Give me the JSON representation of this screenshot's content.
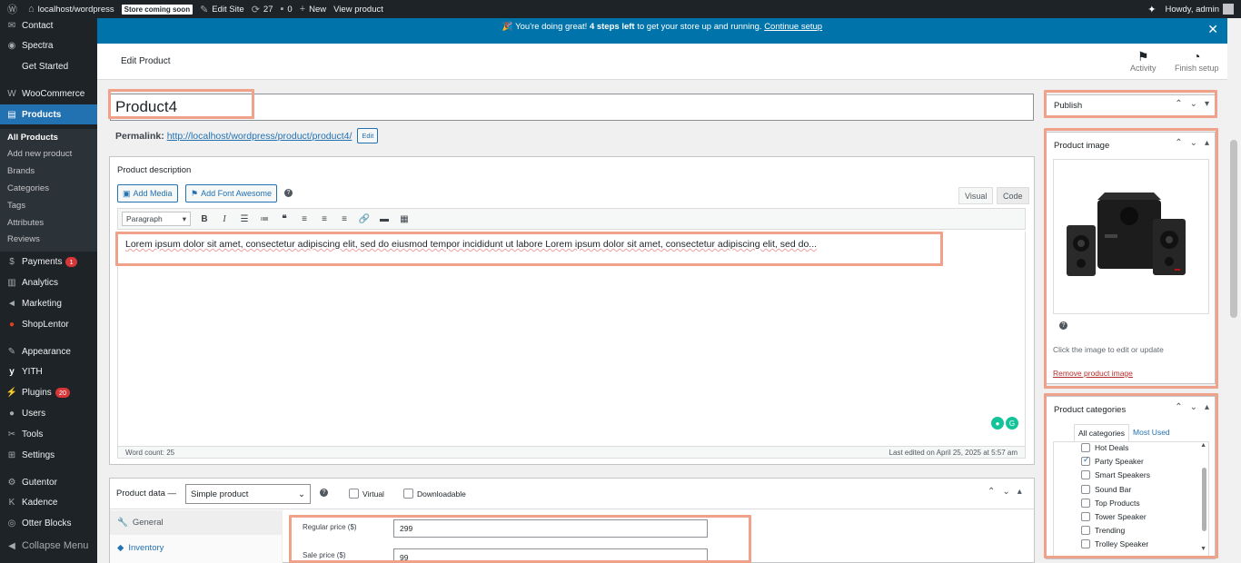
{
  "adminbar": {
    "site": "localhost/wordpress",
    "store_badge": "Store coming soon",
    "edit_site": "Edit Site",
    "updates_count": "27",
    "comments_count": "0",
    "new_label": "New",
    "view_product": "View product",
    "greeting": "Howdy, admin"
  },
  "sidebar": {
    "items": [
      {
        "label": "Contact",
        "icon": "mail-icon"
      },
      {
        "label": "Spectra",
        "icon": "spectra-icon"
      },
      {
        "label": "Get Started",
        "icon": ""
      },
      {
        "label": "WooCommerce",
        "icon": "woo-icon"
      },
      {
        "label": "Products",
        "icon": "products-icon"
      },
      {
        "label": "Payments",
        "icon": "payments-icon",
        "badge": "1"
      },
      {
        "label": "Analytics",
        "icon": "analytics-icon"
      },
      {
        "label": "Marketing",
        "icon": "marketing-icon"
      },
      {
        "label": "ShopLentor",
        "icon": "shoplentor-icon"
      },
      {
        "label": "Appearance",
        "icon": "brush-icon"
      },
      {
        "label": "YITH",
        "icon": "yith-icon"
      },
      {
        "label": "Plugins",
        "icon": "plugin-icon",
        "badge": "20"
      },
      {
        "label": "Users",
        "icon": "users-icon"
      },
      {
        "label": "Tools",
        "icon": "tools-icon"
      },
      {
        "label": "Settings",
        "icon": "settings-icon"
      },
      {
        "label": "Gutentor",
        "icon": "gutentor-icon"
      },
      {
        "label": "Kadence",
        "icon": "kadence-icon"
      },
      {
        "label": "Otter Blocks",
        "icon": "otter-icon"
      },
      {
        "label": "Collapse Menu",
        "icon": "collapse-icon"
      }
    ],
    "submenu": [
      "All Products",
      "Add new product",
      "Brands",
      "Categories",
      "Tags",
      "Attributes",
      "Reviews"
    ]
  },
  "notice": {
    "prefix": "🎉 You're doing great!",
    "bold": "4 steps left",
    "suffix": "to get your store up and running.",
    "link": "Continue setup"
  },
  "header": {
    "title": "Edit Product",
    "activity": "Activity",
    "finish_setup": "Finish setup"
  },
  "product": {
    "title": "Product4",
    "permalink_label": "Permalink:",
    "permalink_url": "http://localhost/wordpress/product/product4/",
    "edit_btn": "Edit"
  },
  "description": {
    "box_title": "Product description",
    "add_media": "Add Media",
    "add_font_awesome": "Add Font Awesome",
    "tab_visual": "Visual",
    "tab_code": "Code",
    "format": "Paragraph",
    "content": "Lorem ipsum dolor sit amet, consectetur adipiscing elit, sed do eiusmod tempor incididunt ut labore Lorem ipsum dolor sit amet, consectetur adipiscing elit, sed do...",
    "word_count": "Word count: 25",
    "last_edited": "Last edited on April 25, 2025 at 5:57 am"
  },
  "product_data": {
    "label": "Product data —",
    "type": "Simple product",
    "virtual": "Virtual",
    "downloadable": "Downloadable",
    "tabs": [
      "General",
      "Inventory"
    ],
    "regular_price_label": "Regular price ($)",
    "regular_price": "299",
    "sale_price_label": "Sale price ($)",
    "sale_price": "99"
  },
  "publish": {
    "title": "Publish"
  },
  "product_image": {
    "title": "Product image",
    "hint": "Click the image to edit or update",
    "remove": "Remove product image"
  },
  "categories": {
    "title": "Product categories",
    "tab_all": "All categories",
    "tab_most": "Most Used",
    "items": [
      {
        "name": "Hot Deals",
        "checked": false
      },
      {
        "name": "Party Speaker",
        "checked": true
      },
      {
        "name": "Smart Speakers",
        "checked": false
      },
      {
        "name": "Sound Bar",
        "checked": false
      },
      {
        "name": "Top Products",
        "checked": false
      },
      {
        "name": "Tower Speaker",
        "checked": false
      },
      {
        "name": "Trending",
        "checked": false
      },
      {
        "name": "Trolley Speaker",
        "checked": false
      }
    ]
  },
  "colors": {
    "accent": "#2271b1",
    "notice": "#0073aa",
    "highlight": "#f0a18a",
    "sidebar": "#1d2327"
  }
}
